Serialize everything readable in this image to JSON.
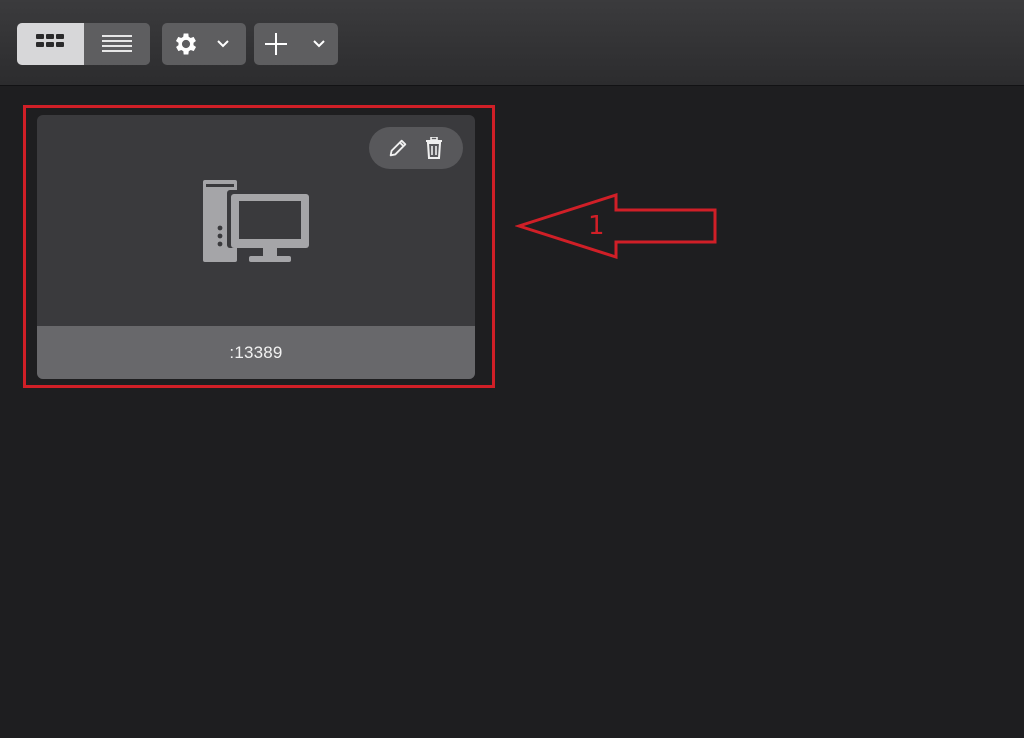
{
  "toolbar": {
    "view_toggle": {
      "options": [
        {
          "id": "grid",
          "icon": "grid-view-icon",
          "selected": true
        },
        {
          "id": "list",
          "icon": "list-view-icon",
          "selected": false
        }
      ]
    },
    "settings_button": {
      "icon": "gear-icon",
      "dropdown_icon": "chevron-down-icon"
    },
    "add_button": {
      "icon": "plus-icon",
      "dropdown_icon": "chevron-down-icon"
    }
  },
  "connection_card": {
    "label": ":13389",
    "device_icon": "desktop-computer-icon",
    "actions": [
      {
        "id": "edit",
        "icon": "pencil-icon"
      },
      {
        "id": "delete",
        "icon": "trash-icon"
      }
    ]
  },
  "annotation": {
    "number": "1",
    "color": "#d01f27"
  },
  "colors": {
    "background": "#1e1e20",
    "card": "#3a3a3d",
    "card_footer": "#68686b",
    "toolbar": "#333335",
    "accent_annotation": "#d01f27"
  }
}
